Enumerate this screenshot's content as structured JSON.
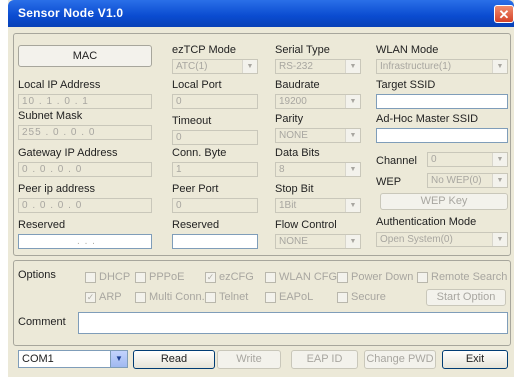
{
  "window": {
    "title": "Sensor Node V1.0",
    "close_glyph": "✕"
  },
  "col1": {
    "mac_button": "MAC",
    "local_ip_label": "Local IP Address",
    "local_ip_value": "10 . 1 . 0 . 1",
    "subnet_label": "Subnet Mask",
    "subnet_value": "255 . 0 . 0 . 0",
    "gateway_label": "Gateway IP Address",
    "gateway_value": "0 . 0 . 0 . 0",
    "peer_ip_label": "Peer ip address",
    "peer_ip_value": "0 . 0 . 0 . 0",
    "reserved_label": "Reserved",
    "reserved_value": ". . ."
  },
  "col2": {
    "mode_label": "ezTCP Mode",
    "mode_value": "ATC(1)",
    "local_port_label": "Local Port",
    "local_port_value": "0",
    "timeout_label": "Timeout",
    "timeout_value": "0",
    "conn_byte_label": "Conn. Byte",
    "conn_byte_value": "1",
    "peer_port_label": "Peer Port",
    "peer_port_value": "0",
    "reserved_label": "Reserved",
    "reserved_value": ""
  },
  "col3": {
    "serial_type_label": "Serial Type",
    "serial_type_value": "RS-232",
    "baudrate_label": "Baudrate",
    "baudrate_value": "19200",
    "parity_label": "Parity",
    "parity_value": "NONE",
    "data_bits_label": "Data Bits",
    "data_bits_value": "8",
    "stop_bit_label": "Stop Bit",
    "stop_bit_value": "1Bit",
    "flow_control_label": "Flow Control",
    "flow_control_value": "NONE"
  },
  "col4": {
    "wlan_mode_label": "WLAN Mode",
    "wlan_mode_value": "Infrastructure(1)",
    "target_ssid_label": "Target SSID",
    "target_ssid_value": "",
    "adhoc_ssid_label": "Ad-Hoc Master SSID",
    "adhoc_ssid_value": "",
    "channel_label": "Channel",
    "channel_value": "0",
    "wep_label": "WEP",
    "wep_value": "No WEP(0)",
    "wep_key_button": "WEP Key",
    "auth_mode_label": "Authentication Mode",
    "auth_mode_value": "Open System(0)"
  },
  "options": {
    "label": "Options",
    "dhcp": "DHCP",
    "pppoe": "PPPoE",
    "ezcfg": "ezCFG",
    "wlan_cfg": "WLAN CFG",
    "power_down": "Power Down",
    "remote_search": "Remote Search",
    "arp": "ARP",
    "multi_conn": "Multi Conn.",
    "telnet": "Telnet",
    "eapol": "EAPoL",
    "secure": "Secure",
    "start_option": "Start Option"
  },
  "comment": {
    "label": "Comment",
    "value": ""
  },
  "bottom": {
    "port": "COM1",
    "read": "Read",
    "write": "Write",
    "eap_id": "EAP ID",
    "change_pwd": "Change PWD",
    "exit": "Exit"
  }
}
